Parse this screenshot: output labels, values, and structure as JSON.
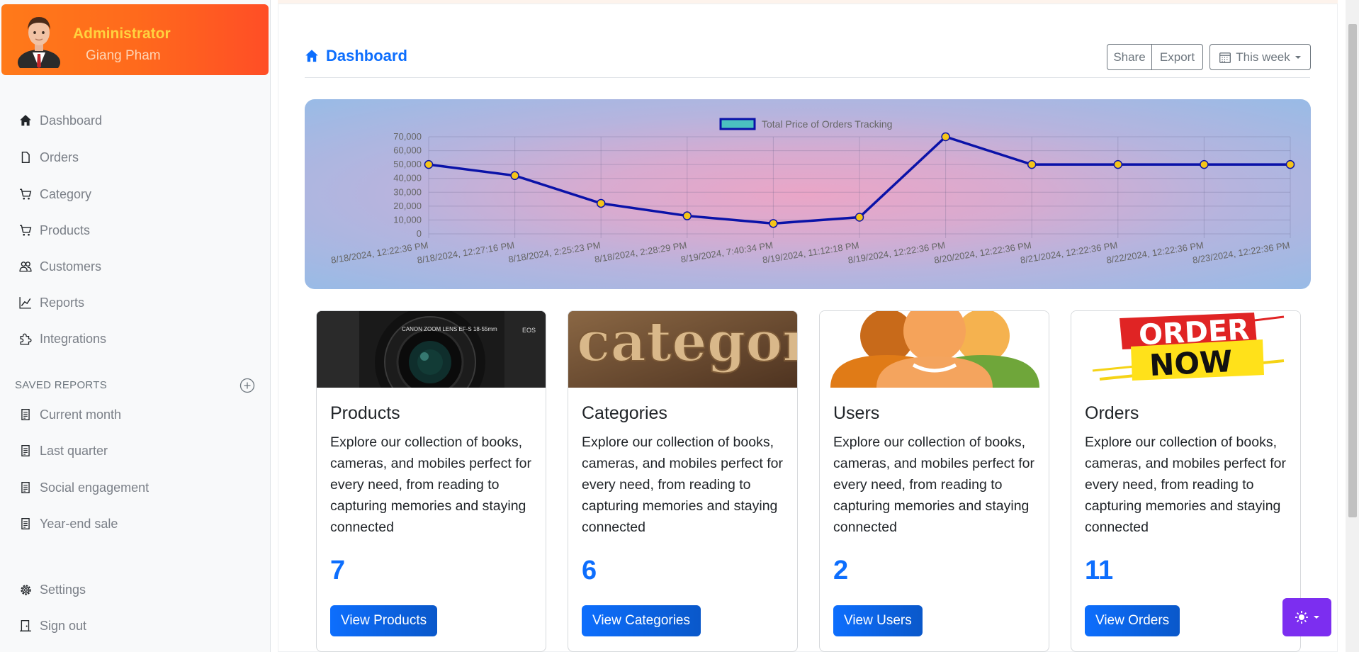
{
  "profile": {
    "role": "Administrator",
    "name": "Giang Pham"
  },
  "nav": {
    "items": [
      {
        "label": "Dashboard",
        "icon": "house-icon"
      },
      {
        "label": "Orders",
        "icon": "file-icon"
      },
      {
        "label": "Category",
        "icon": "cart-icon"
      },
      {
        "label": "Products",
        "icon": "cart-icon"
      },
      {
        "label": "Customers",
        "icon": "people-icon"
      },
      {
        "label": "Reports",
        "icon": "graph-icon"
      },
      {
        "label": "Integrations",
        "icon": "puzzle-icon"
      }
    ]
  },
  "saved_reports": {
    "heading": "SAVED REPORTS",
    "items": [
      {
        "label": "Current month",
        "icon": "file-text-icon"
      },
      {
        "label": "Last quarter",
        "icon": "file-text-icon"
      },
      {
        "label": "Social engagement",
        "icon": "file-text-icon"
      },
      {
        "label": "Year-end sale",
        "icon": "file-text-icon"
      }
    ]
  },
  "footer_nav": {
    "settings": "Settings",
    "sign_out": "Sign out"
  },
  "header": {
    "title": "Dashboard",
    "share": "Share",
    "export": "Export",
    "range": "This week"
  },
  "chart_data": {
    "type": "line",
    "legend": "Total Price of Orders Tracking",
    "categories": [
      "8/18/2024, 12:22:36 PM",
      "8/18/2024, 12:27:16 PM",
      "8/18/2024, 2:25:23 PM",
      "8/18/2024, 2:28:29 PM",
      "8/19/2024, 7:40:34 PM",
      "8/19/2024, 11:12:18 PM",
      "8/19/2024, 12:22:36 PM",
      "8/20/2024, 12:22:36 PM",
      "8/21/2024, 12:22:36 PM",
      "8/22/2024, 12:22:36 PM",
      "8/23/2024, 12:22:36 PM"
    ],
    "values": [
      50000,
      42000,
      22000,
      13000,
      7500,
      12000,
      70000,
      50000,
      50000,
      50000,
      50000
    ],
    "y_ticks": [
      "0",
      "10,000",
      "20,000",
      "30,000",
      "40,000",
      "50,000",
      "60,000",
      "70,000"
    ],
    "ylim": [
      0,
      70000
    ],
    "grid": true,
    "legend_position": "top",
    "line_color": "#0a12a8",
    "point_color": "#f5c518"
  },
  "cards": [
    {
      "title": "Products",
      "text": "Explore our collection of books, cameras, and mobiles perfect for every need, from reading to capturing memories and staying connected",
      "count": "7",
      "button": "View Products"
    },
    {
      "title": "Categories",
      "text": "Explore our collection of books, cameras, and mobiles perfect for every need, from reading to capturing memories and staying connected",
      "count": "6",
      "button": "View Categories"
    },
    {
      "title": "Users",
      "text": "Explore our collection of books, cameras, and mobiles perfect for every need, from reading to capturing memories and staying connected",
      "count": "2",
      "button": "View Users"
    },
    {
      "title": "Orders",
      "text": "Explore our collection of books, cameras, and mobiles perfect for every need, from reading to capturing memories and staying connected",
      "count": "11",
      "button": "View Orders"
    }
  ],
  "card_images": {
    "categories_word": "category",
    "orders_banner_line1": "ORDER",
    "orders_banner_line2": "NOW"
  },
  "colors": {
    "accent": "#0d6efd",
    "profile_gradient": "#ff6a1c",
    "theme_toggle": "#7c2ef0"
  }
}
